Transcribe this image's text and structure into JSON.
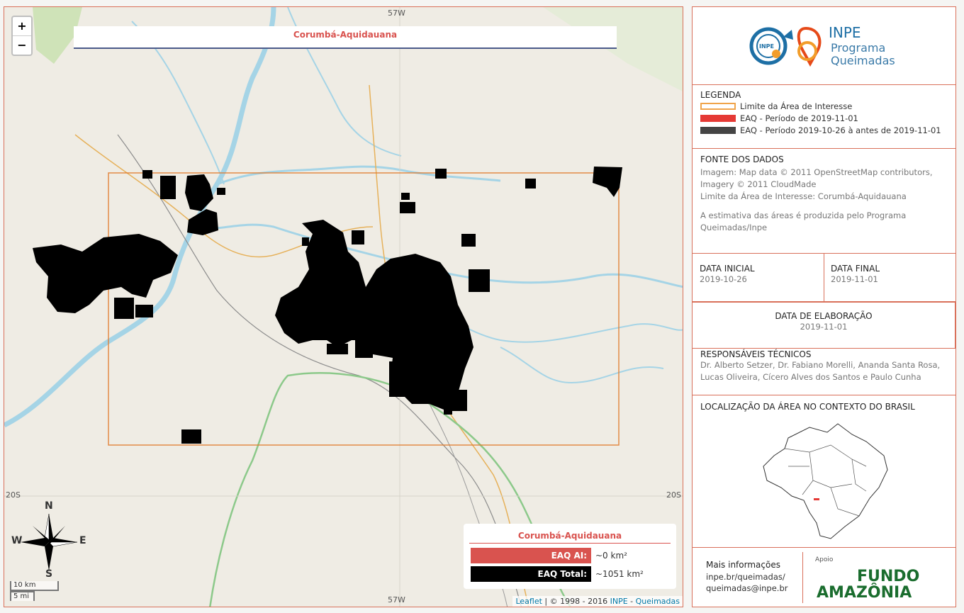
{
  "map": {
    "title": "Corumbá-Aquidauana",
    "zoom_in": "+",
    "zoom_out": "−",
    "coords": {
      "top": "57W",
      "bottom": "57W",
      "left": "20S",
      "right": "20S"
    },
    "compass": {
      "n": "N",
      "s": "S",
      "e": "E",
      "w": "W"
    },
    "scale": {
      "km": "10 km",
      "mi": "5 mi"
    },
    "stats": {
      "title": "Corumbá-Aquidauana",
      "eaq_ai_label": "EAQ AI:",
      "eaq_ai_value": "~0 km²",
      "eaq_total_label": "EAQ Total:",
      "eaq_total_value": "~1051 km²"
    },
    "attribution": {
      "leaflet": "Leaflet",
      "mid": " | © 1998 - 2016 ",
      "inpe": "INPE",
      "dash": " - ",
      "queimadas": "Queimadas"
    },
    "colors": {
      "aoi_border": "#e07a2c",
      "burn_recent": "#e53935",
      "burn_previous": "#000000",
      "river": "#a5d4e6",
      "road_green": "#8cc98a"
    }
  },
  "panel": {
    "logo": {
      "inpe_small": "INPE",
      "name": "INPE",
      "program_line1": "Programa",
      "program_line2": "Queimadas"
    },
    "legend": {
      "title": "LEGENDA",
      "items": [
        {
          "label": "Limite da Área de Interesse",
          "color": "#f0a44a",
          "style": "outline"
        },
        {
          "label": "EAQ - Período de 2019-11-01",
          "color": "#e53935",
          "style": "fill"
        },
        {
          "label": "EAQ - Período 2019-10-26 à antes de 2019-11-01",
          "color": "#444444",
          "style": "fill"
        }
      ]
    },
    "sources": {
      "title": "FONTE DOS DADOS",
      "line1": "Imagem: Map data © 2011 OpenStreetMap contributors,",
      "line2": "Imagery © 2011 CloudMade",
      "line3": "Limite da Área de Interesse: Corumbá-Aquidauana",
      "line4": "A estimativa das áreas é produzida pelo Programa",
      "line5": "Queimadas/Inpe"
    },
    "dates": {
      "start_label": "DATA INICIAL",
      "start_value": "2019-10-26",
      "end_label": "DATA FINAL",
      "end_value": "2019-11-01",
      "made_label": "DATA DE ELABORAÇÃO",
      "made_value": "2019-11-01"
    },
    "responsible": {
      "title": "RESPONSÁVEIS TÉCNICOS",
      "line1": "Dr. Alberto Setzer, Dr. Fabiano Morelli, Ananda Santa Rosa,",
      "line2": "Lucas Oliveira, Cícero Alves dos Santos e Paulo Cunha"
    },
    "location": {
      "title": "LOCALIZAÇÃO DA ÁREA NO CONTEXTO DO BRASIL"
    },
    "more_info": {
      "title": "Mais informações",
      "line1": "inpe.br/queimadas/",
      "line2": "queimadas@inpe.br",
      "support": "Apoio",
      "fundo": "FUNDO",
      "amazonia": "AMAZÔNIA"
    }
  }
}
